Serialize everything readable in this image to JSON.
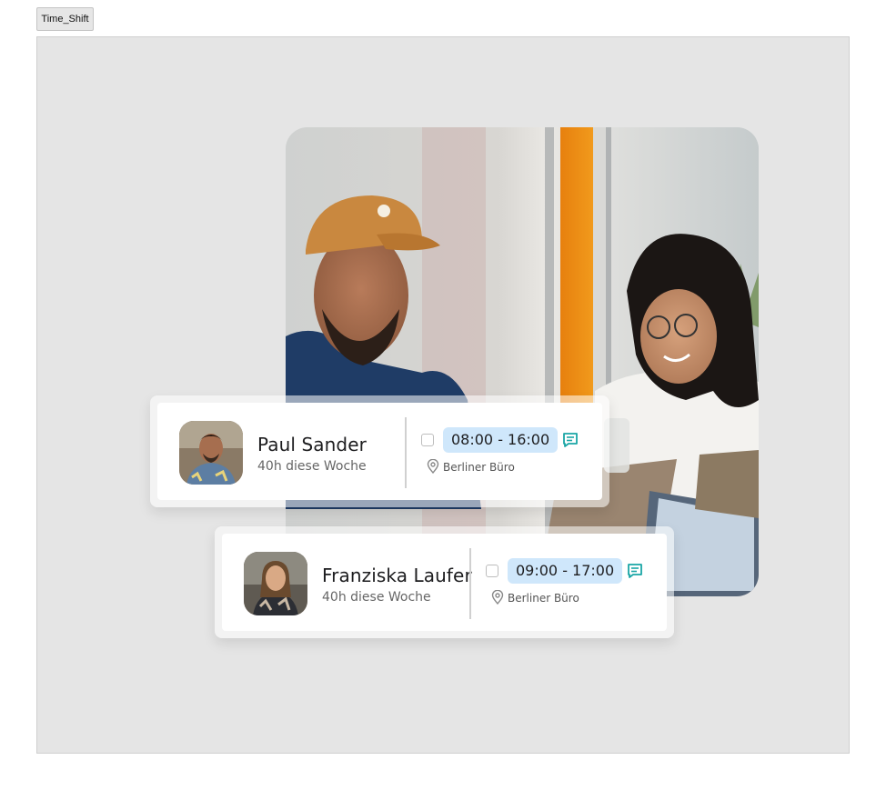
{
  "window": {
    "tab_label": "Time_Shift"
  },
  "shifts": [
    {
      "name": "Paul Sander",
      "hours": "40h diese Woche",
      "time": "08:00 - 16:00",
      "location": "Berliner Büro"
    },
    {
      "name": "Franziska Laufer",
      "hours": "40h diese Woche",
      "time": "09:00 - 17:00",
      "location": "Berliner Büro"
    }
  ],
  "icons": {
    "chat": "chat-bubble-icon",
    "location": "map-pin-icon"
  },
  "colors": {
    "time_pill": "#cfe7fb",
    "chat_icon": "#1aa6a6"
  }
}
